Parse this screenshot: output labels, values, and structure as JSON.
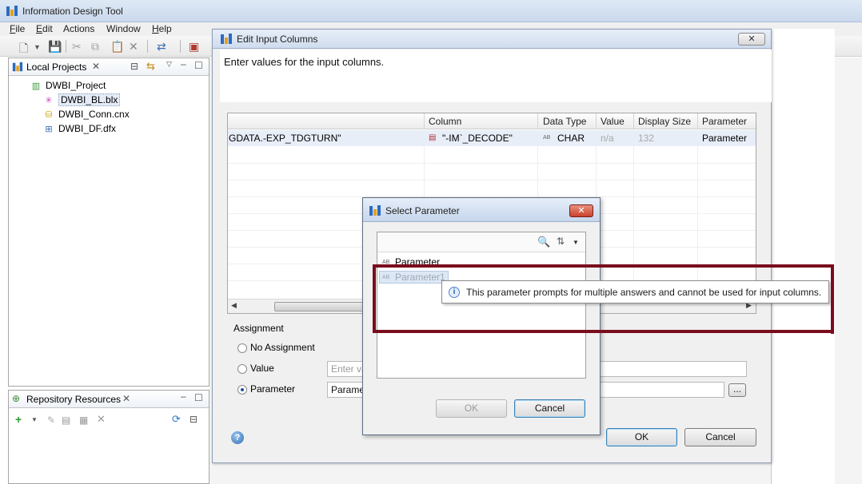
{
  "app": {
    "title": "Information Design Tool",
    "menus": [
      "File",
      "Edit",
      "Actions",
      "Window",
      "Help"
    ],
    "menu_underline": [
      "F",
      "E",
      "",
      "",
      "H"
    ]
  },
  "local_projects": {
    "tab_label": "Local Projects",
    "project": "DWBI_Project",
    "files": [
      "DWBI_BL.blx",
      "DWBI_Conn.cnx",
      "DWBI_DF.dfx"
    ]
  },
  "repository": {
    "tab_label": "Repository Resources"
  },
  "edit_input_columns": {
    "title": "Edit Input Columns",
    "message": "Enter values for the input columns.",
    "columns": [
      "Column",
      "Data Type",
      "Value",
      "Display Size",
      "Parameter"
    ],
    "row": {
      "table": "GDATA.-EXP_TDGTURN\"",
      "column": "\"-IM`_DECODE\"",
      "data_type_badge": "AB",
      "data_type": "CHAR",
      "value": "n/a",
      "display_size": "132",
      "parameter": "Parameter"
    },
    "assignment_label": "Assignment",
    "options": [
      "No Assignment",
      "Value",
      "Parameter"
    ],
    "selected_option": "Parameter",
    "value_placeholder": "Enter va",
    "parameter_field": "Parame",
    "browse_label": "...",
    "ok_label": "OK",
    "cancel_label": "Cancel",
    "help_label": "?"
  },
  "select_parameter": {
    "title": "Select Parameter",
    "items": [
      {
        "badge": "AB",
        "label": "Parameter"
      },
      {
        "badge": "AB",
        "label": "Parameter1"
      }
    ],
    "ok_label": "OK",
    "cancel_label": "Cancel"
  },
  "tooltip": {
    "text": "This parameter prompts for multiple answers and cannot be used for input columns."
  },
  "colors": {
    "highlight": "#7a0d1c",
    "accent": "#3c7fb1"
  }
}
